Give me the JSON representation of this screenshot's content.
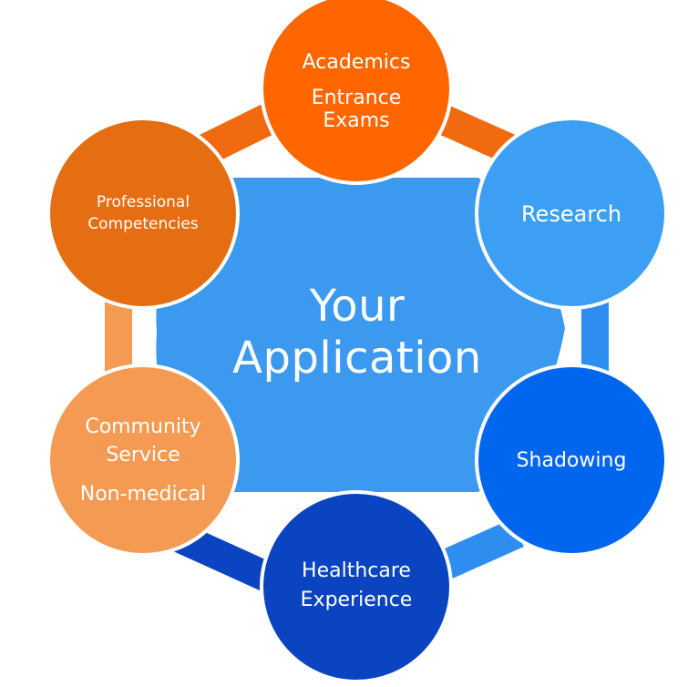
{
  "diagram": {
    "center": {
      "lines": [
        "Your",
        "Application"
      ]
    },
    "nodes": [
      {
        "id": "academics",
        "lines": [
          "Academics",
          "Entrance",
          "Exams"
        ]
      },
      {
        "id": "research",
        "lines": [
          "Research"
        ]
      },
      {
        "id": "shadowing",
        "lines": [
          "Shadowing"
        ]
      },
      {
        "id": "healthcare",
        "lines": [
          "Healthcare",
          "Experience"
        ]
      },
      {
        "id": "community",
        "lines": [
          "Community",
          "Service",
          "Non-medical"
        ]
      },
      {
        "id": "professional",
        "lines": [
          "Professional",
          "Competencies"
        ]
      }
    ]
  },
  "colors": {
    "center": "#3b99f0",
    "academics": "#ff6600",
    "research": "#3d9ff4",
    "shadowing": "#0066ee",
    "healthcare": "#0a44c0",
    "community": "#f59a52",
    "professional": "#e56d12",
    "ring_orange": "#f26a10",
    "ring_light_orange": "#f59a52",
    "ring_blue": "#2e8ef0",
    "ring_dark_blue": "#0a44c0",
    "node_border": "#ffffff"
  }
}
